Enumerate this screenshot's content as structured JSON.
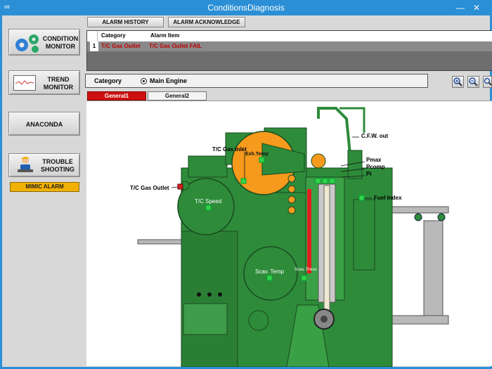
{
  "window": {
    "title": "ConditionsDiagnosis"
  },
  "sidebar": {
    "condition_monitor": "CONDITION\nMONITOR",
    "trend_monitor": "TREND\nMONITOR",
    "anaconda": "ANACONDA",
    "trouble_shooting": "TROUBLE\nSHOOTING",
    "mimic_alarm": "MIMIC ALARM"
  },
  "toolbar": {
    "alarm_history": "ALARM HISTORY",
    "alarm_acknowledge": "ALARM ACKNOWLEDGE"
  },
  "alarm_table": {
    "columns": [
      "Category",
      "Alarm Item"
    ],
    "rows": [
      {
        "index": "1",
        "category": "T/C Gas Outlet",
        "alarm_item": "T/C Gas Outlet FAIL"
      }
    ]
  },
  "category_bar": {
    "label": "Category",
    "option": "Main Engine"
  },
  "tabs": [
    "General1",
    "General2"
  ],
  "diagram": {
    "labels": {
      "cfw_out": "C.F.W. out",
      "tc_gas_inlet": "T/C Gas Inlet",
      "exh_temp": "Exh.Temp",
      "pmax": "Pmax",
      "pcomp": "Pcomp",
      "pi": "Pi",
      "tc_gas_outlet": "T/C Gas Outlet",
      "fuel_index": "Fuel Index",
      "tc_speed": "T/C Speed",
      "scav_temp": "Scav. Temp",
      "scav_press": "Scav. Press"
    }
  },
  "colors": {
    "accent": "#2b8fd6",
    "engine_green": "#2e8b3a",
    "alarm_red": "#cc0000",
    "mimic_yellow": "#f2b100",
    "exhaust_orange": "#f59a1c"
  }
}
